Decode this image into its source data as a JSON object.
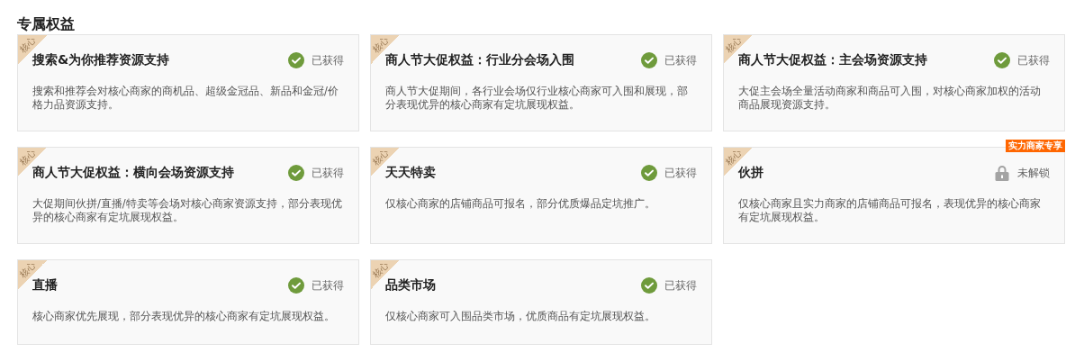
{
  "title": "专属权益",
  "cards": [
    {
      "corner_tag": "核心",
      "title": "搜索&为你推荐资源支持",
      "unlocked": true,
      "status_text": "已获得",
      "description": "搜索和推荐会对核心商家的商机品、超级金冠品、新品和金冠/价格力品资源支持。"
    },
    {
      "corner_tag": "核心",
      "title": "商人节大促权益：行业分会场入围",
      "unlocked": true,
      "status_text": "已获得",
      "description": "商人节大促期间，各行业会场仅行业核心商家可入围和展现，部分表现优异的核心商家有定坑展现权益。"
    },
    {
      "corner_tag": "核心",
      "title": "商人节大促权益：主会场资源支持",
      "unlocked": true,
      "status_text": "已获得",
      "description": "大促主会场全量活动商家和商品可入围，对核心商家加权的活动商品展现资源支持。"
    },
    {
      "corner_tag": "核心",
      "title": "商人节大促权益：横向会场资源支持",
      "unlocked": true,
      "status_text": "已获得",
      "description": "大促期间伙拼/直播/特卖等会场对核心商家资源支持，部分表现优异的核心商家有定坑展现权益。"
    },
    {
      "corner_tag": "核心",
      "title": "天天特卖",
      "unlocked": true,
      "status_text": "已获得",
      "description": "仅核心商家的店铺商品可报名，部分优质爆品定坑推广。"
    },
    {
      "corner_tag": "核心",
      "title": "伙拼",
      "unlocked": false,
      "status_text": "未解锁",
      "badge": "实力商家专享",
      "description": "仅核心商家且实力商家的店铺商品可报名，表现优异的核心商家有定坑展现权益。"
    },
    {
      "corner_tag": "核心",
      "title": "直播",
      "unlocked": true,
      "status_text": "已获得",
      "description": "核心商家优先展现，部分表现优异的核心商家有定坑展现权益。"
    },
    {
      "corner_tag": "核心",
      "title": "品类市场",
      "unlocked": true,
      "status_text": "已获得",
      "description": "仅核心商家可入围品类市场，优质商品有定坑展现权益。"
    }
  ]
}
